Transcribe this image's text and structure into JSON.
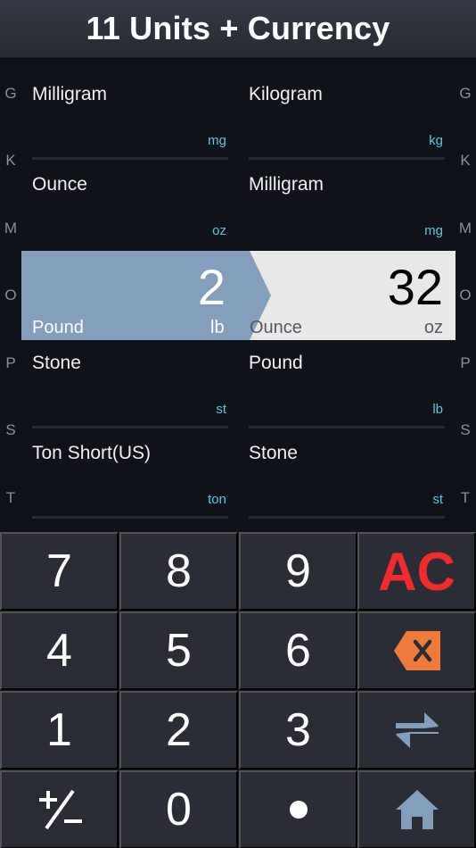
{
  "header": {
    "title": "11 Units + Currency"
  },
  "index_letters": [
    "G",
    "K",
    "M",
    "O",
    "P",
    "S",
    "T"
  ],
  "left_units": [
    {
      "name": "Milligram",
      "abbr": "mg"
    },
    {
      "name": "Ounce",
      "abbr": "oz"
    },
    {
      "name": "Stone",
      "abbr": "st"
    },
    {
      "name": "Ton Short(US)",
      "abbr": "ton"
    }
  ],
  "right_units": [
    {
      "name": "Kilogram",
      "abbr": "kg"
    },
    {
      "name": "Milligram",
      "abbr": "mg"
    },
    {
      "name": "Pound",
      "abbr": "lb"
    },
    {
      "name": "Stone",
      "abbr": "st"
    }
  ],
  "selected": {
    "from": {
      "value": "2",
      "name": "Pound",
      "abbr": "lb"
    },
    "to": {
      "value": "32",
      "name": "Ounce",
      "abbr": "oz"
    }
  },
  "keypad": {
    "k7": "7",
    "k8": "8",
    "k9": "9",
    "ac": "AC",
    "k4": "4",
    "k5": "5",
    "k6": "6",
    "k1": "1",
    "k2": "2",
    "k3": "3",
    "k0": "0"
  },
  "colors": {
    "accent_blue": "#839fbd",
    "abbr_cyan": "#5cc6d8",
    "ac_red": "#ef2b2b",
    "backspace_orange": "#f07a3c"
  },
  "icons": {
    "backspace": "backspace-icon",
    "swap": "swap-icon",
    "home": "home-icon",
    "plus_minus": "plus-minus-icon",
    "decimal": "decimal-point-icon"
  }
}
